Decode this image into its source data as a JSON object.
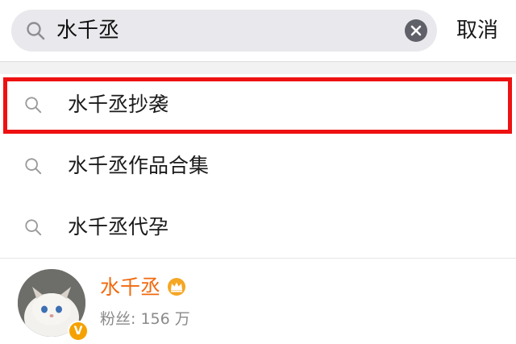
{
  "search": {
    "value": "水千丞",
    "cancel_label": "取消"
  },
  "suggestions": [
    {
      "label": "水千丞抄袭"
    },
    {
      "label": "水千丞作品合集"
    },
    {
      "label": "水千丞代孕"
    }
  ],
  "user": {
    "name": "水千丞",
    "followers_label": "粉丝: 156 万",
    "badge": "V"
  },
  "colors": {
    "highlight": "#ee1111",
    "user_name": "#f06a0f",
    "badge": "#f5a100"
  },
  "icons": [
    "search-icon",
    "clear-icon",
    "crown-icon",
    "verified-icon"
  ]
}
